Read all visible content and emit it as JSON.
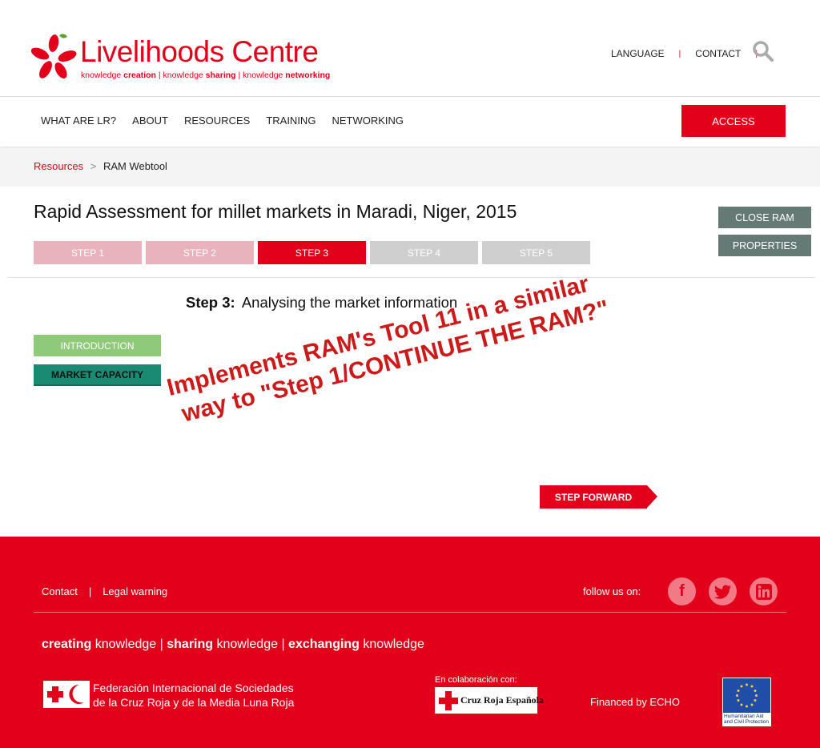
{
  "header": {
    "logo_title": "Livelihoods Centre",
    "logo_tagline": {
      "p1a": "knowledge ",
      "p1b": "creation",
      "sep1": " | ",
      "p2a": "knowledge ",
      "p2b": "sharing",
      "sep2": " | ",
      "p3a": "knowledge ",
      "p3b": "networking"
    },
    "top_links": [
      "LANGUAGE",
      "CONTACT"
    ],
    "search_icon": "search-icon"
  },
  "nav": {
    "items": [
      "WHAT ARE LR?",
      "ABOUT",
      "RESOURCES",
      "TRAINING",
      "NETWORKING"
    ],
    "access_label": "ACCESS"
  },
  "breadcrumb": {
    "link": "Resources",
    "separator": ">",
    "current": "RAM Webtool"
  },
  "main": {
    "title": "Rapid Assessment for millet markets in Maradi, Niger, 2015",
    "close_label": "CLOSE RAM",
    "properties_label": "PROPERTIES",
    "steps": [
      {
        "label": "STEP 1",
        "state": "done"
      },
      {
        "label": "STEP 2",
        "state": "done"
      },
      {
        "label": "STEP 3",
        "state": "active"
      },
      {
        "label": "STEP 4",
        "state": "todo"
      },
      {
        "label": "STEP 5",
        "state": "todo"
      }
    ],
    "step_heading_bold": "Step 3:",
    "step_heading_text": "Analysing the market information",
    "intro_label": "INTRODUCTION",
    "market_label": "MARKET CAPACITY",
    "annotation_line1": "Implements RAM's Tool 11 in a similar",
    "annotation_line2": "way to \"Step 1/CONTINUE THE RAM?\"",
    "forward_label": "STEP FORWARD"
  },
  "footer": {
    "contact": "Contact",
    "separator": "|",
    "legal": "Legal warning",
    "follow": "follow us on:",
    "social": [
      "facebook-icon",
      "twitter-icon",
      "linkedin-icon"
    ],
    "motto": {
      "b1": "creating",
      "t1": " knowledge | ",
      "b2": "sharing",
      "t2": " knowledge | ",
      "b3": "exchanging",
      "t3": " knowledge"
    },
    "ifrc_line1": "Federación Internacional de Sociedades",
    "ifrc_line2": "de la Cruz Roja y de la Media Luna Roja",
    "colab": "En colaboración con:",
    "cruz_roja": "Cruz Roja Española",
    "financed": "Financed by ECHO",
    "eu_line1": "Humanitarian Aid",
    "eu_line2": "and Civil Protection"
  },
  "colors": {
    "brand_red": "#e2001a",
    "step_done": "#e8b3bd",
    "step_todo": "#cfcfcf",
    "side_button": "#667a75",
    "intro_green": "#8fc97a",
    "market_teal": "#1a8a72"
  }
}
